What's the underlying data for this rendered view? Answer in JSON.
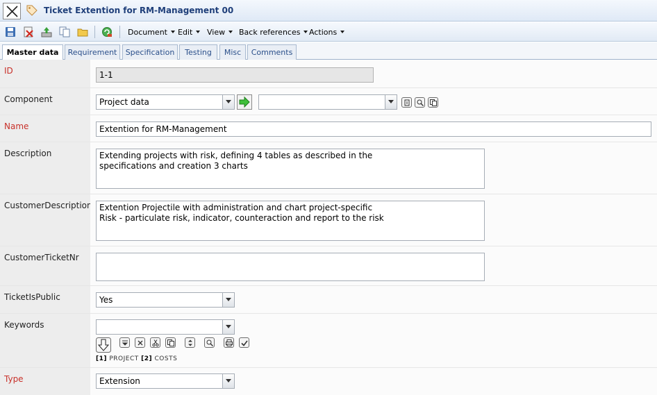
{
  "window": {
    "title": "Ticket Extention for RM-Management 00"
  },
  "toolbar": {
    "icons": [
      "save-icon",
      "delete-icon",
      "export-icon",
      "copy-icon",
      "folder-icon",
      "refresh-icon"
    ],
    "menus": [
      {
        "id": "document",
        "label": "Document"
      },
      {
        "id": "edit",
        "label": "Edit"
      },
      {
        "id": "view",
        "label": "View"
      },
      {
        "id": "back-references",
        "label": "Back references"
      },
      {
        "id": "actions",
        "label": "Actions"
      }
    ]
  },
  "tabs": [
    {
      "id": "master-data",
      "label": "Master data",
      "active": true
    },
    {
      "id": "requirement",
      "label": "Requirement",
      "active": false
    },
    {
      "id": "specification",
      "label": "Specification",
      "active": false
    },
    {
      "id": "testing",
      "label": "Testing",
      "active": false
    },
    {
      "id": "misc",
      "label": "Misc",
      "active": false
    },
    {
      "id": "comments",
      "label": "Comments",
      "active": false
    }
  ],
  "form": {
    "id": {
      "label": "ID",
      "value": "1-1"
    },
    "component": {
      "label": "Component",
      "value": "Project data",
      "sub_value": ""
    },
    "name": {
      "label": "Name",
      "value": "Extention for RM-Management"
    },
    "description": {
      "label": "Description",
      "value": "Extending projects with risk, defining 4 tables as described in the\nspecifications and creation 3 charts"
    },
    "customer_description": {
      "label": "CustomerDescription",
      "value": "Extention Projectile with administration and chart project-specific\nRisk - particulate risk, indicator, counteraction and report to the risk"
    },
    "customer_ticket_nr": {
      "label": "CustomerTicketNr",
      "value": ""
    },
    "ticket_is_public": {
      "label": "TicketIsPublic",
      "value": "Yes"
    },
    "keywords": {
      "label": "Keywords",
      "value": "",
      "legend": [
        {
          "index": "[1]",
          "text": "PROJECT"
        },
        {
          "index": "[2]",
          "text": "COSTS"
        }
      ]
    },
    "type": {
      "label": "Type",
      "value": "Extension"
    }
  },
  "colors": {
    "required_label": "#c8312a",
    "title_text": "#1f3f7a",
    "tab_text": "#2a4f8a",
    "label_background": "#ededed"
  }
}
